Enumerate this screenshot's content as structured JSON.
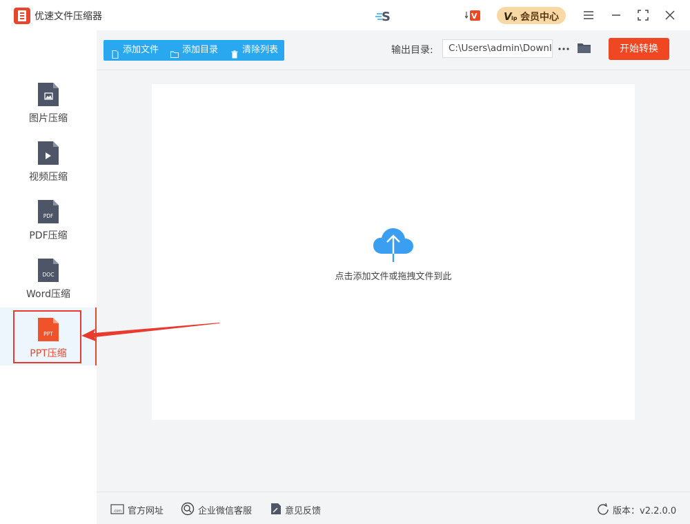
{
  "window": {
    "title": "优速文件压缩器",
    "vip_label": "会员中心"
  },
  "sidebar": {
    "items": [
      {
        "label": "图片压缩",
        "icon": "image-file-icon",
        "badge": ""
      },
      {
        "label": "视频压缩",
        "icon": "video-file-icon",
        "badge": ""
      },
      {
        "label": "PDF压缩",
        "icon": "pdf-file-icon",
        "badge": "PDF"
      },
      {
        "label": "Word压缩",
        "icon": "doc-file-icon",
        "badge": "DOC"
      },
      {
        "label": "PPT压缩",
        "icon": "ppt-file-icon",
        "badge": "PPT"
      }
    ],
    "active_index": 4
  },
  "toolbar": {
    "add_file": "添加文件",
    "add_folder": "添加目录",
    "clear_list": "清除列表",
    "output_label": "输出目录:",
    "output_path": "C:\\Users\\admin\\Downlc",
    "start_label": "开始转换"
  },
  "drop": {
    "hint": "点击添加文件或拖拽文件到此"
  },
  "footer": {
    "website": "官方网址",
    "wechat": "企业微信客服",
    "feedback": "意见反馈",
    "version": "版本：v2.2.0.0"
  },
  "colors": {
    "accent_blue": "#29a8f0",
    "accent_red": "#ef4722",
    "icon_gray": "#4d5566",
    "ppt_orange": "#f0522a"
  }
}
